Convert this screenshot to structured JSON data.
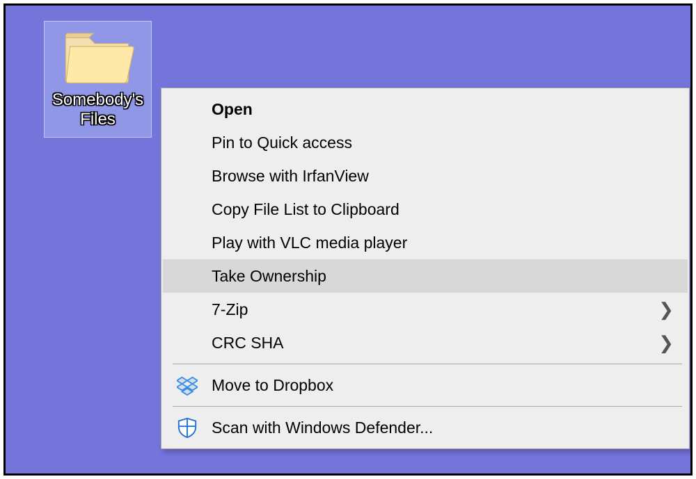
{
  "desktop": {
    "folder_label": "Somebody's\nFiles"
  },
  "context_menu": {
    "items": [
      {
        "label": "Open",
        "default": true
      },
      {
        "label": "Pin to Quick access"
      },
      {
        "label": "Browse with IrfanView"
      },
      {
        "label": "Copy File List to Clipboard"
      },
      {
        "label": "Play with VLC media player"
      },
      {
        "label": "Take Ownership",
        "highlight": true
      },
      {
        "label": "7-Zip",
        "submenu": true
      },
      {
        "label": "CRC SHA",
        "submenu": true
      },
      {
        "separator": true
      },
      {
        "label": "Move to Dropbox",
        "icon": "dropbox"
      },
      {
        "separator": true
      },
      {
        "label": "Scan with Windows Defender...",
        "icon": "defender"
      }
    ]
  },
  "colors": {
    "desktop_bg": "#7474db",
    "menu_bg": "#eeeeee",
    "menu_highlight": "#d8d8d8"
  }
}
